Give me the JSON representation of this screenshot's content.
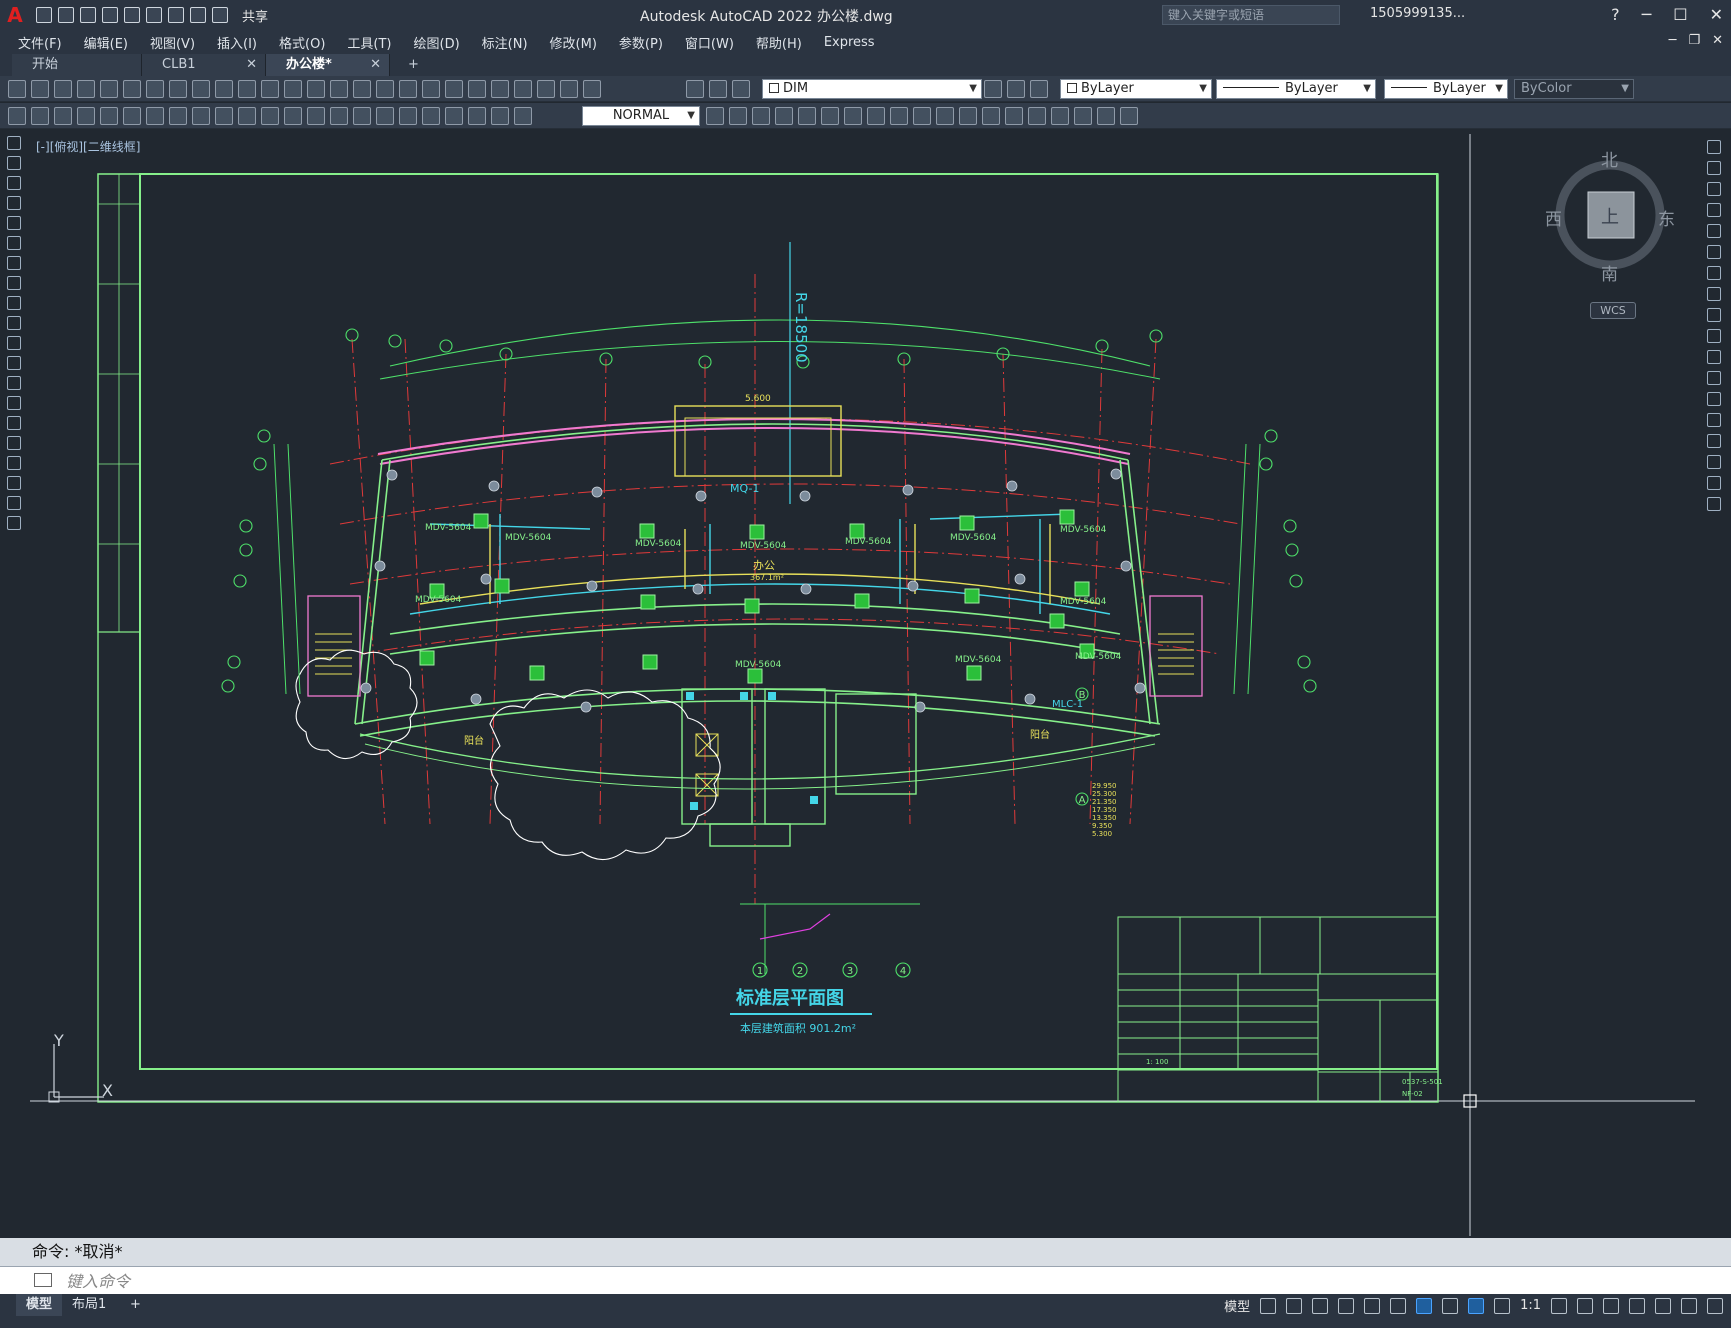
{
  "app": {
    "logo": "A",
    "title": "Autodesk AutoCAD 2022    办公楼.dwg",
    "share_label": "共享",
    "search_placeholder": "键入关键字或短语",
    "user": "1505999135...",
    "help": "?"
  },
  "menu": [
    "文件(F)",
    "编辑(E)",
    "视图(V)",
    "插入(I)",
    "格式(O)",
    "工具(T)",
    "绘图(D)",
    "标注(N)",
    "修改(M)",
    "参数(P)",
    "窗口(W)",
    "帮助(H)",
    "Express"
  ],
  "tabs": [
    {
      "label": "开始"
    },
    {
      "label": "CLB1"
    },
    {
      "label": "办公楼*"
    }
  ],
  "tab_add": "+",
  "toolbar": {
    "layer": "DIM",
    "color": "ByLayer",
    "linetype": "ByLayer",
    "lineweight": "ByLayer",
    "plotstyle": "ByColor",
    "dimstyle": "NORMAL"
  },
  "viewport_label": "[-][俯视][二维线框]",
  "viewcube": {
    "north": "北",
    "south": "南",
    "east": "东",
    "west": "西",
    "top": "上",
    "wcs": "WCS"
  },
  "drawing": {
    "title": "标准层平面图",
    "subtitle": "本层建筑面积    901.2m²",
    "elevation_mark": "R=18500",
    "room_office": "办公",
    "room_office_area": "367.1m²",
    "curtain_wall": "MQ-1",
    "window_mark": "MLC-1",
    "unit_label": "MDV-5604",
    "balcony": "阳台",
    "dimension_top": "5.600",
    "axis_bottom": [
      "1",
      "2",
      "3",
      "4"
    ],
    "axis_a": "A",
    "axis_b": "B"
  },
  "title_block": {
    "drawing_no": "0537-S-501",
    "sheet": "NF-02",
    "scale": "1: 100"
  },
  "command": {
    "history": "命令: *取消*",
    "placeholder": "键入命令"
  },
  "layouts": [
    {
      "label": "模型"
    },
    {
      "label": "布局1"
    }
  ],
  "status": {
    "model": "模型",
    "scale": "1:1"
  }
}
